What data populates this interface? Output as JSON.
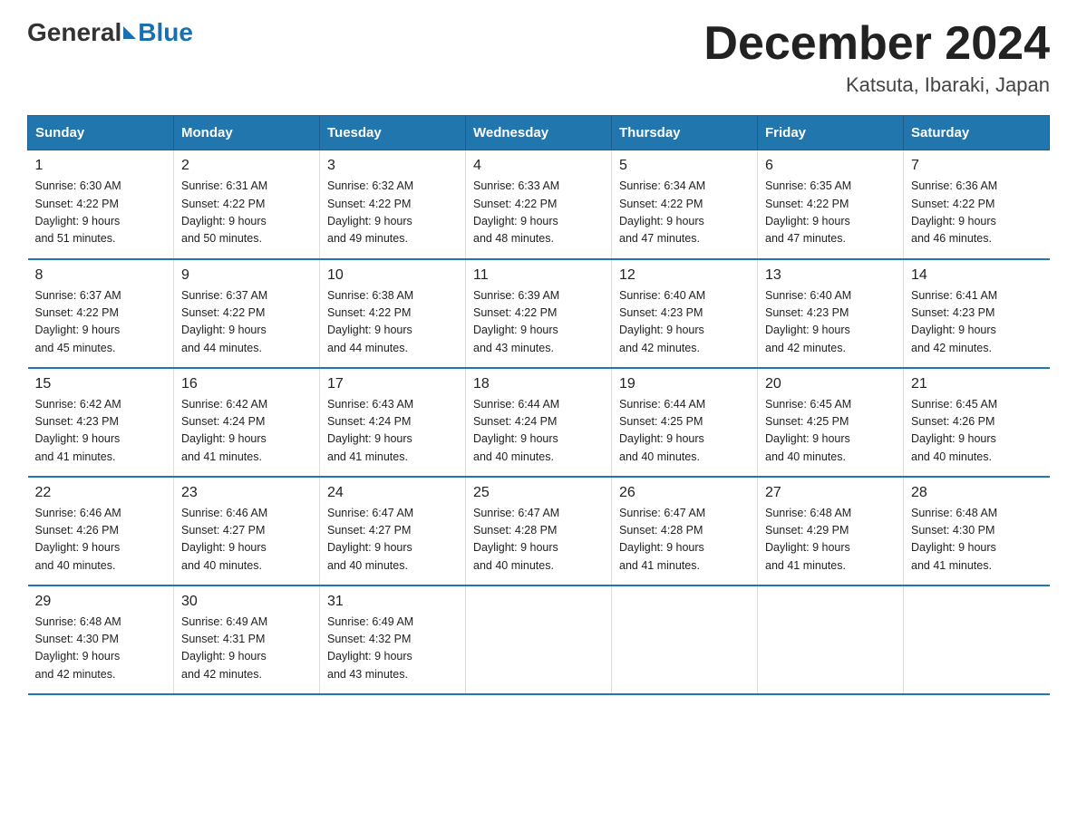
{
  "header": {
    "logo_general": "General",
    "logo_blue": "Blue",
    "title": "December 2024",
    "location": "Katsuta, Ibaraki, Japan"
  },
  "days_of_week": [
    "Sunday",
    "Monday",
    "Tuesday",
    "Wednesday",
    "Thursday",
    "Friday",
    "Saturday"
  ],
  "weeks": [
    [
      {
        "day": "1",
        "sunrise": "6:30 AM",
        "sunset": "4:22 PM",
        "daylight": "9 hours and 51 minutes."
      },
      {
        "day": "2",
        "sunrise": "6:31 AM",
        "sunset": "4:22 PM",
        "daylight": "9 hours and 50 minutes."
      },
      {
        "day": "3",
        "sunrise": "6:32 AM",
        "sunset": "4:22 PM",
        "daylight": "9 hours and 49 minutes."
      },
      {
        "day": "4",
        "sunrise": "6:33 AM",
        "sunset": "4:22 PM",
        "daylight": "9 hours and 48 minutes."
      },
      {
        "day": "5",
        "sunrise": "6:34 AM",
        "sunset": "4:22 PM",
        "daylight": "9 hours and 47 minutes."
      },
      {
        "day": "6",
        "sunrise": "6:35 AM",
        "sunset": "4:22 PM",
        "daylight": "9 hours and 47 minutes."
      },
      {
        "day": "7",
        "sunrise": "6:36 AM",
        "sunset": "4:22 PM",
        "daylight": "9 hours and 46 minutes."
      }
    ],
    [
      {
        "day": "8",
        "sunrise": "6:37 AM",
        "sunset": "4:22 PM",
        "daylight": "9 hours and 45 minutes."
      },
      {
        "day": "9",
        "sunrise": "6:37 AM",
        "sunset": "4:22 PM",
        "daylight": "9 hours and 44 minutes."
      },
      {
        "day": "10",
        "sunrise": "6:38 AM",
        "sunset": "4:22 PM",
        "daylight": "9 hours and 44 minutes."
      },
      {
        "day": "11",
        "sunrise": "6:39 AM",
        "sunset": "4:22 PM",
        "daylight": "9 hours and 43 minutes."
      },
      {
        "day": "12",
        "sunrise": "6:40 AM",
        "sunset": "4:23 PM",
        "daylight": "9 hours and 42 minutes."
      },
      {
        "day": "13",
        "sunrise": "6:40 AM",
        "sunset": "4:23 PM",
        "daylight": "9 hours and 42 minutes."
      },
      {
        "day": "14",
        "sunrise": "6:41 AM",
        "sunset": "4:23 PM",
        "daylight": "9 hours and 42 minutes."
      }
    ],
    [
      {
        "day": "15",
        "sunrise": "6:42 AM",
        "sunset": "4:23 PM",
        "daylight": "9 hours and 41 minutes."
      },
      {
        "day": "16",
        "sunrise": "6:42 AM",
        "sunset": "4:24 PM",
        "daylight": "9 hours and 41 minutes."
      },
      {
        "day": "17",
        "sunrise": "6:43 AM",
        "sunset": "4:24 PM",
        "daylight": "9 hours and 41 minutes."
      },
      {
        "day": "18",
        "sunrise": "6:44 AM",
        "sunset": "4:24 PM",
        "daylight": "9 hours and 40 minutes."
      },
      {
        "day": "19",
        "sunrise": "6:44 AM",
        "sunset": "4:25 PM",
        "daylight": "9 hours and 40 minutes."
      },
      {
        "day": "20",
        "sunrise": "6:45 AM",
        "sunset": "4:25 PM",
        "daylight": "9 hours and 40 minutes."
      },
      {
        "day": "21",
        "sunrise": "6:45 AM",
        "sunset": "4:26 PM",
        "daylight": "9 hours and 40 minutes."
      }
    ],
    [
      {
        "day": "22",
        "sunrise": "6:46 AM",
        "sunset": "4:26 PM",
        "daylight": "9 hours and 40 minutes."
      },
      {
        "day": "23",
        "sunrise": "6:46 AM",
        "sunset": "4:27 PM",
        "daylight": "9 hours and 40 minutes."
      },
      {
        "day": "24",
        "sunrise": "6:47 AM",
        "sunset": "4:27 PM",
        "daylight": "9 hours and 40 minutes."
      },
      {
        "day": "25",
        "sunrise": "6:47 AM",
        "sunset": "4:28 PM",
        "daylight": "9 hours and 40 minutes."
      },
      {
        "day": "26",
        "sunrise": "6:47 AM",
        "sunset": "4:28 PM",
        "daylight": "9 hours and 41 minutes."
      },
      {
        "day": "27",
        "sunrise": "6:48 AM",
        "sunset": "4:29 PM",
        "daylight": "9 hours and 41 minutes."
      },
      {
        "day": "28",
        "sunrise": "6:48 AM",
        "sunset": "4:30 PM",
        "daylight": "9 hours and 41 minutes."
      }
    ],
    [
      {
        "day": "29",
        "sunrise": "6:48 AM",
        "sunset": "4:30 PM",
        "daylight": "9 hours and 42 minutes."
      },
      {
        "day": "30",
        "sunrise": "6:49 AM",
        "sunset": "4:31 PM",
        "daylight": "9 hours and 42 minutes."
      },
      {
        "day": "31",
        "sunrise": "6:49 AM",
        "sunset": "4:32 PM",
        "daylight": "9 hours and 43 minutes."
      },
      null,
      null,
      null,
      null
    ]
  ],
  "labels": {
    "sunrise": "Sunrise:",
    "sunset": "Sunset:",
    "daylight": "Daylight:"
  }
}
